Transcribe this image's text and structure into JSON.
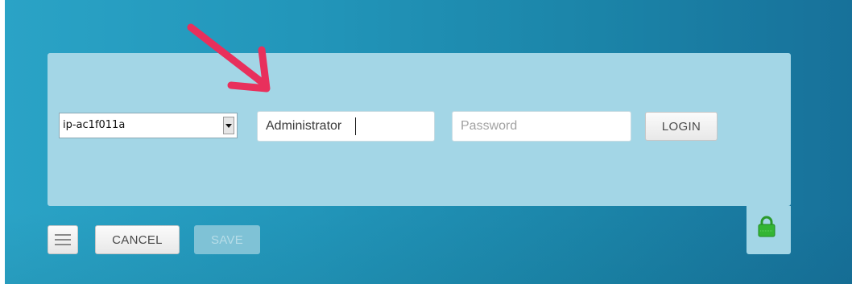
{
  "login": {
    "server_select": {
      "value": "ip-ac1f011a"
    },
    "username_field": {
      "value": "Administrator"
    },
    "password_field": {
      "placeholder": "Password",
      "value": ""
    },
    "login_label": "LOGIN"
  },
  "footer": {
    "menu_icon": "hamburger-menu-icon",
    "cancel_label": "CANCEL",
    "save_label": "SAVE",
    "lock_icon": "padlock-icon"
  },
  "annotation": {
    "icon": "red-arrow-icon",
    "color": "#e8305c"
  },
  "colors": {
    "background": "#2296ba",
    "panel": "#a3d6e6",
    "lock_green": "#2fae2f"
  }
}
